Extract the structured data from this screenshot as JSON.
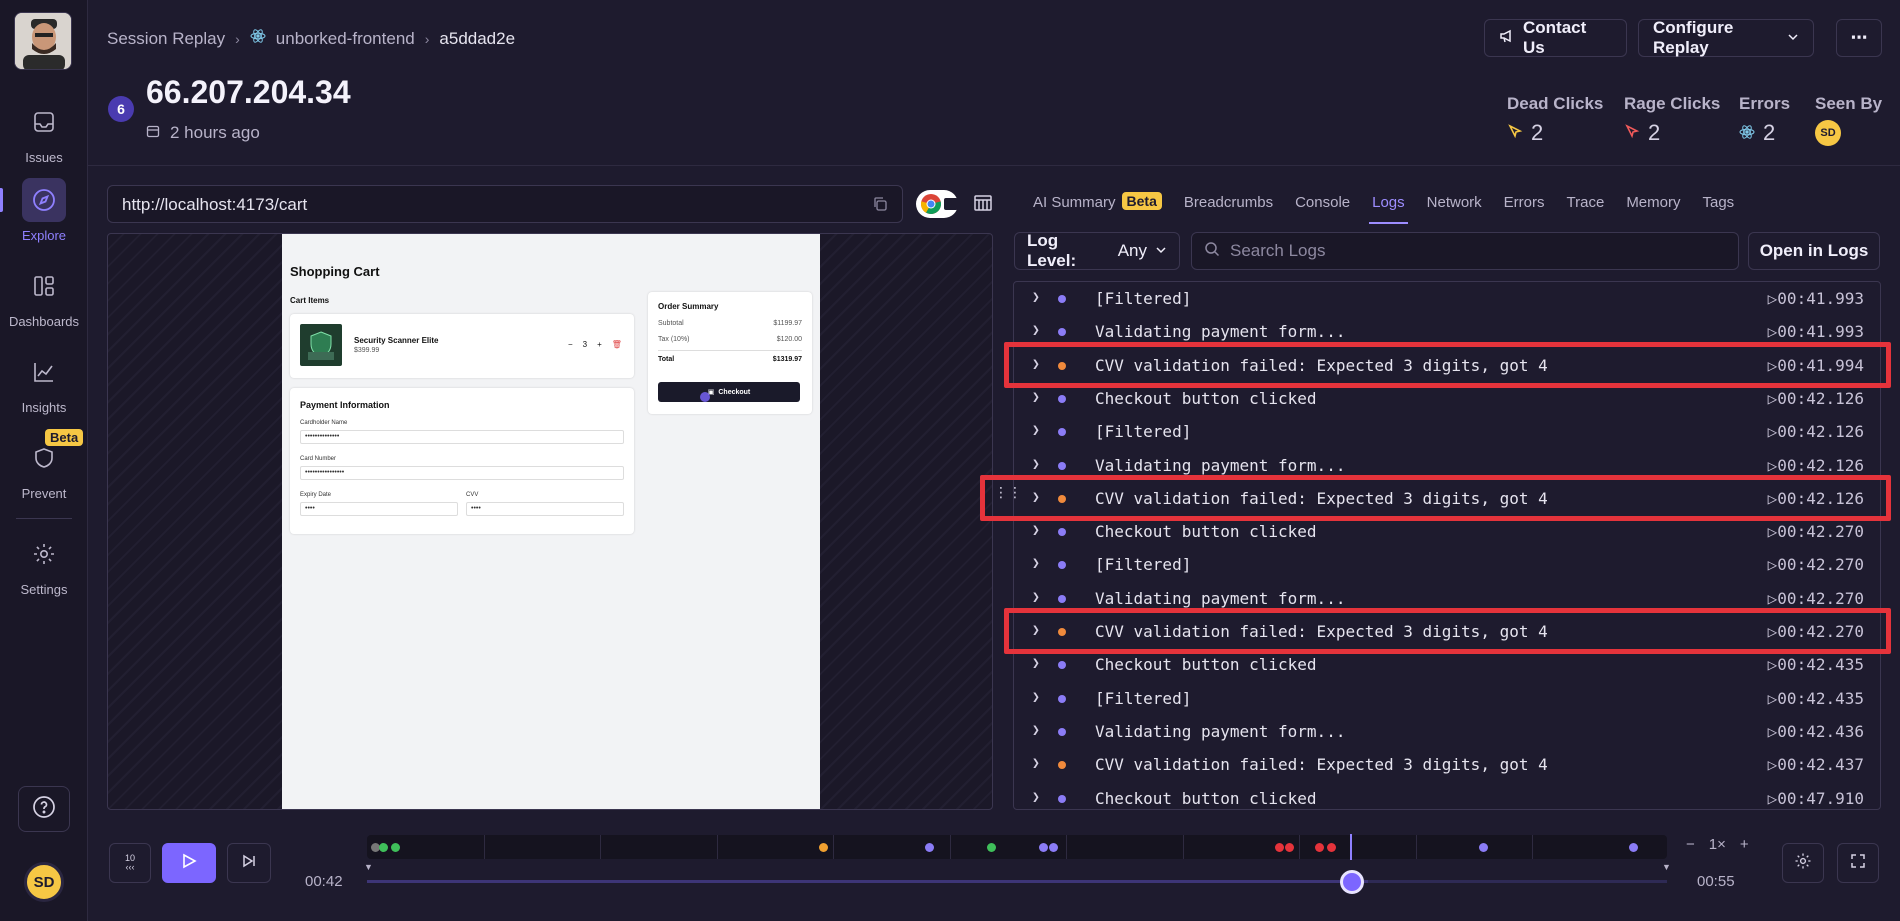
{
  "sidebar": {
    "items": [
      {
        "label": "Issues",
        "icon": "inbox-icon"
      },
      {
        "label": "Explore",
        "icon": "compass-icon"
      },
      {
        "label": "Dashboards",
        "icon": "dashboard-icon"
      },
      {
        "label": "Insights",
        "icon": "chart-icon"
      },
      {
        "label": "Prevent",
        "icon": "shield-icon",
        "badge": "Beta"
      },
      {
        "label": "Settings",
        "icon": "gear-icon"
      }
    ],
    "user_initials": "SD",
    "active_color": "#8f80ff"
  },
  "breadcrumb": {
    "root": "Session Replay",
    "project": "unborked-frontend",
    "replay_id": "a5ddad2e"
  },
  "header": {
    "contact_label": "Contact Us",
    "configure_label": "Configure Replay",
    "more_label": "⋯",
    "badge_count": "6",
    "title": "66.207.204.34",
    "time_ago": "2 hours ago",
    "stats": {
      "dead_clicks_label": "Dead Clicks",
      "dead_clicks": "2",
      "rage_clicks_label": "Rage Clicks",
      "rage_clicks": "2",
      "errors_label": "Errors",
      "errors": "2",
      "seen_by_label": "Seen By",
      "seen_by": "SD"
    }
  },
  "url": "http://localhost:4173/cart",
  "preview": {
    "title": "Shopping Cart",
    "cart_items_label": "Cart Items",
    "item_name": "Security Scanner Elite",
    "item_price": "$399.99",
    "qty_minus": "−",
    "qty": "3",
    "qty_plus": "+",
    "payment_title": "Payment Information",
    "cardholder_label": "Cardholder Name",
    "cardholder_value": "••••••••••••••",
    "card_label": "Card Number",
    "card_value": "••••••••••••••••",
    "expiry_label": "Expiry Date",
    "expiry_value": "••••",
    "cvv_label": "CVV",
    "cvv_value": "••••",
    "summary_title": "Order Summary",
    "subtotal_label": "Subtotal",
    "subtotal": "$1199.97",
    "tax_label": "Tax (10%)",
    "tax": "$120.00",
    "total_label": "Total",
    "total": "$1319.97",
    "checkout_label": "Checkout"
  },
  "tabs": [
    {
      "label": "AI Summary",
      "badge": "Beta"
    },
    {
      "label": "Breadcrumbs"
    },
    {
      "label": "Console"
    },
    {
      "label": "Logs",
      "active": true
    },
    {
      "label": "Network"
    },
    {
      "label": "Errors"
    },
    {
      "label": "Trace"
    },
    {
      "label": "Memory"
    },
    {
      "label": "Tags"
    }
  ],
  "logs_toolbar": {
    "level_label": "Log Level:",
    "level_value": "Any",
    "search_placeholder": "Search Logs",
    "open_label": "Open in Logs"
  },
  "logs": [
    {
      "msg": "[Filtered]",
      "ts": "00:41.993",
      "level": "info"
    },
    {
      "msg": "Validating payment form...",
      "ts": "00:41.993",
      "level": "info"
    },
    {
      "msg": "CVV validation failed: Expected 3 digits, got 4",
      "ts": "00:41.994",
      "level": "warn",
      "highlight": true
    },
    {
      "msg": "Checkout button clicked",
      "ts": "00:42.126",
      "level": "info"
    },
    {
      "msg": "[Filtered]",
      "ts": "00:42.126",
      "level": "info"
    },
    {
      "msg": "Validating payment form...",
      "ts": "00:42.126",
      "level": "info"
    },
    {
      "msg": "CVV validation failed: Expected 3 digits, got 4",
      "ts": "00:42.126",
      "level": "warn",
      "highlight": true
    },
    {
      "msg": "Checkout button clicked",
      "ts": "00:42.270",
      "level": "info"
    },
    {
      "msg": "[Filtered]",
      "ts": "00:42.270",
      "level": "info"
    },
    {
      "msg": "Validating payment form...",
      "ts": "00:42.270",
      "level": "info"
    },
    {
      "msg": "CVV validation failed: Expected 3 digits, got 4",
      "ts": "00:42.270",
      "level": "warn",
      "highlight": true
    },
    {
      "msg": "Checkout button clicked",
      "ts": "00:42.435",
      "level": "info"
    },
    {
      "msg": "[Filtered]",
      "ts": "00:42.435",
      "level": "info"
    },
    {
      "msg": "Validating payment form...",
      "ts": "00:42.436",
      "level": "info"
    },
    {
      "msg": "CVV validation failed: Expected 3 digits, got 4",
      "ts": "00:42.437",
      "level": "warn"
    },
    {
      "msg": "Checkout button clicked",
      "ts": "00:47.910",
      "level": "info"
    }
  ],
  "colors": {
    "info_dot": "#8b7cf6",
    "warn_dot": "#f08a3c",
    "highlight": "#e5333b",
    "accent": "#7c66ff",
    "beta": "#f6c744"
  },
  "player": {
    "skip_label": "10",
    "current_time": "00:42",
    "duration": "00:55",
    "speed": "1×",
    "speed_minus": "−",
    "speed_plus": "+",
    "progress_fraction": 0.77
  }
}
